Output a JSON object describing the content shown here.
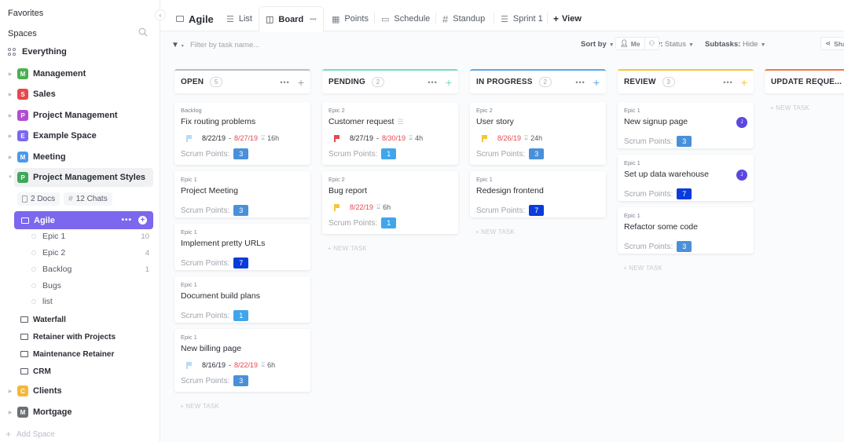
{
  "sidebar": {
    "favorites": "Favorites",
    "spaces": "Spaces",
    "everything": "Everything",
    "spaces_list": [
      {
        "letter": "M",
        "name": "Management",
        "color": "#4caf50"
      },
      {
        "letter": "S",
        "name": "Sales",
        "color": "#e5484d"
      },
      {
        "letter": "P",
        "name": "Project Management",
        "color": "#b04ecf"
      },
      {
        "letter": "E",
        "name": "Example Space",
        "color": "#7b68ee"
      },
      {
        "letter": "M",
        "name": "Meeting",
        "color": "#4a9be8"
      },
      {
        "letter": "P",
        "name": "Project Management Styles",
        "color": "#3fa85b"
      }
    ],
    "chips": {
      "docs": "2 Docs",
      "chats": "12 Chats"
    },
    "active_folder": "Agile",
    "lists": [
      {
        "name": "Epic 1",
        "count": "10"
      },
      {
        "name": "Epic 2",
        "count": "4"
      },
      {
        "name": "Backlog",
        "count": "1"
      },
      {
        "name": "Bugs",
        "count": ""
      },
      {
        "name": "list",
        "count": ""
      }
    ],
    "folders": [
      "Waterfall",
      "Retainer with Projects",
      "Maintenance Retainer",
      "CRM"
    ],
    "more_spaces": [
      {
        "letter": "C",
        "name": "Clients",
        "color": "#f5b73b"
      },
      {
        "letter": "M",
        "name": "Mortgage",
        "color": "#6b6f76"
      }
    ],
    "add_space": "Add Space"
  },
  "header": {
    "title": "Agile",
    "tabs": [
      {
        "label": "List"
      },
      {
        "label": "Board"
      },
      {
        "label": "Points"
      },
      {
        "label": "Schedule"
      },
      {
        "label": "Standup"
      },
      {
        "label": "Sprint 1"
      }
    ],
    "add_view": "View"
  },
  "toolbar": {
    "filter_placeholder": "Filter by task name...",
    "sort_by": "Sort by",
    "group_by_label": "Group by:",
    "group_by_value": "Status",
    "subtasks_label": "Subtasks:",
    "subtasks_value": "Hide",
    "me": "Me",
    "share": "Sha"
  },
  "board": {
    "new_task": "+ NEW TASK",
    "points_label": "Scrum Points:",
    "columns": [
      {
        "title": "OPEN",
        "count": "5",
        "color": "#b9bec7",
        "cards": [
          {
            "list": "Backlog",
            "title": "Fix routing problems",
            "flag": "#b5dcfb",
            "start": "8/22/19",
            "due": "8/27/19",
            "estimate": "16h",
            "points": "3",
            "points_color": "#4a90d9"
          },
          {
            "list": "Epic 1",
            "title": "Project Meeting",
            "points": "3",
            "points_color": "#4a90d9"
          },
          {
            "list": "Epic 1",
            "title": "Implement pretty URLs",
            "points": "7",
            "points_color": "#0a3bdb"
          },
          {
            "list": "Epic 1",
            "title": "Document build plans",
            "points": "1",
            "points_color": "#41a5ec"
          },
          {
            "list": "Epic 1",
            "title": "New billing page",
            "flag": "#b5dcfb",
            "start": "8/16/19",
            "due": "8/22/19",
            "estimate": "6h",
            "points": "3",
            "points_color": "#4a90d9"
          }
        ]
      },
      {
        "title": "PENDING",
        "count": "2",
        "color": "#78dcc2",
        "cards": [
          {
            "list": "Epic 2",
            "title": "Customer request",
            "has_desc": true,
            "flag": "#e5484d",
            "start": "8/27/19",
            "due": "8/30/19",
            "estimate": "4h",
            "points": "1",
            "points_color": "#41a5ec"
          },
          {
            "list": "Epic 2",
            "title": "Bug report",
            "flag": "#f5c53b",
            "due": "8/22/19",
            "estimate": "6h",
            "points": "1",
            "points_color": "#41a5ec"
          }
        ]
      },
      {
        "title": "IN PROGRESS",
        "count": "2",
        "color": "#5aa9ec",
        "cards": [
          {
            "list": "Epic 2",
            "title": "User story",
            "flag": "#f5c53b",
            "due": "8/26/19",
            "estimate": "24h",
            "points": "3",
            "points_color": "#4a90d9"
          },
          {
            "list": "Epic 1",
            "title": "Redesign frontend",
            "points": "7",
            "points_color": "#0a3bdb"
          }
        ]
      },
      {
        "title": "REVIEW",
        "count": "3",
        "color": "#f5c53b",
        "cards": [
          {
            "list": "Epic 1",
            "title": "New signup page",
            "avatar": "J",
            "points": "3",
            "points_color": "#4a90d9"
          },
          {
            "list": "Epic 1",
            "title": "Set up data warehouse",
            "avatar": "J",
            "points": "7",
            "points_color": "#0a3bdb"
          },
          {
            "list": "Epic 1",
            "title": "Refactor some code",
            "points": "3",
            "points_color": "#4a90d9"
          }
        ]
      },
      {
        "title": "UPDATE REQUE...",
        "count": "",
        "color": "#f0764b",
        "cards": []
      }
    ]
  }
}
